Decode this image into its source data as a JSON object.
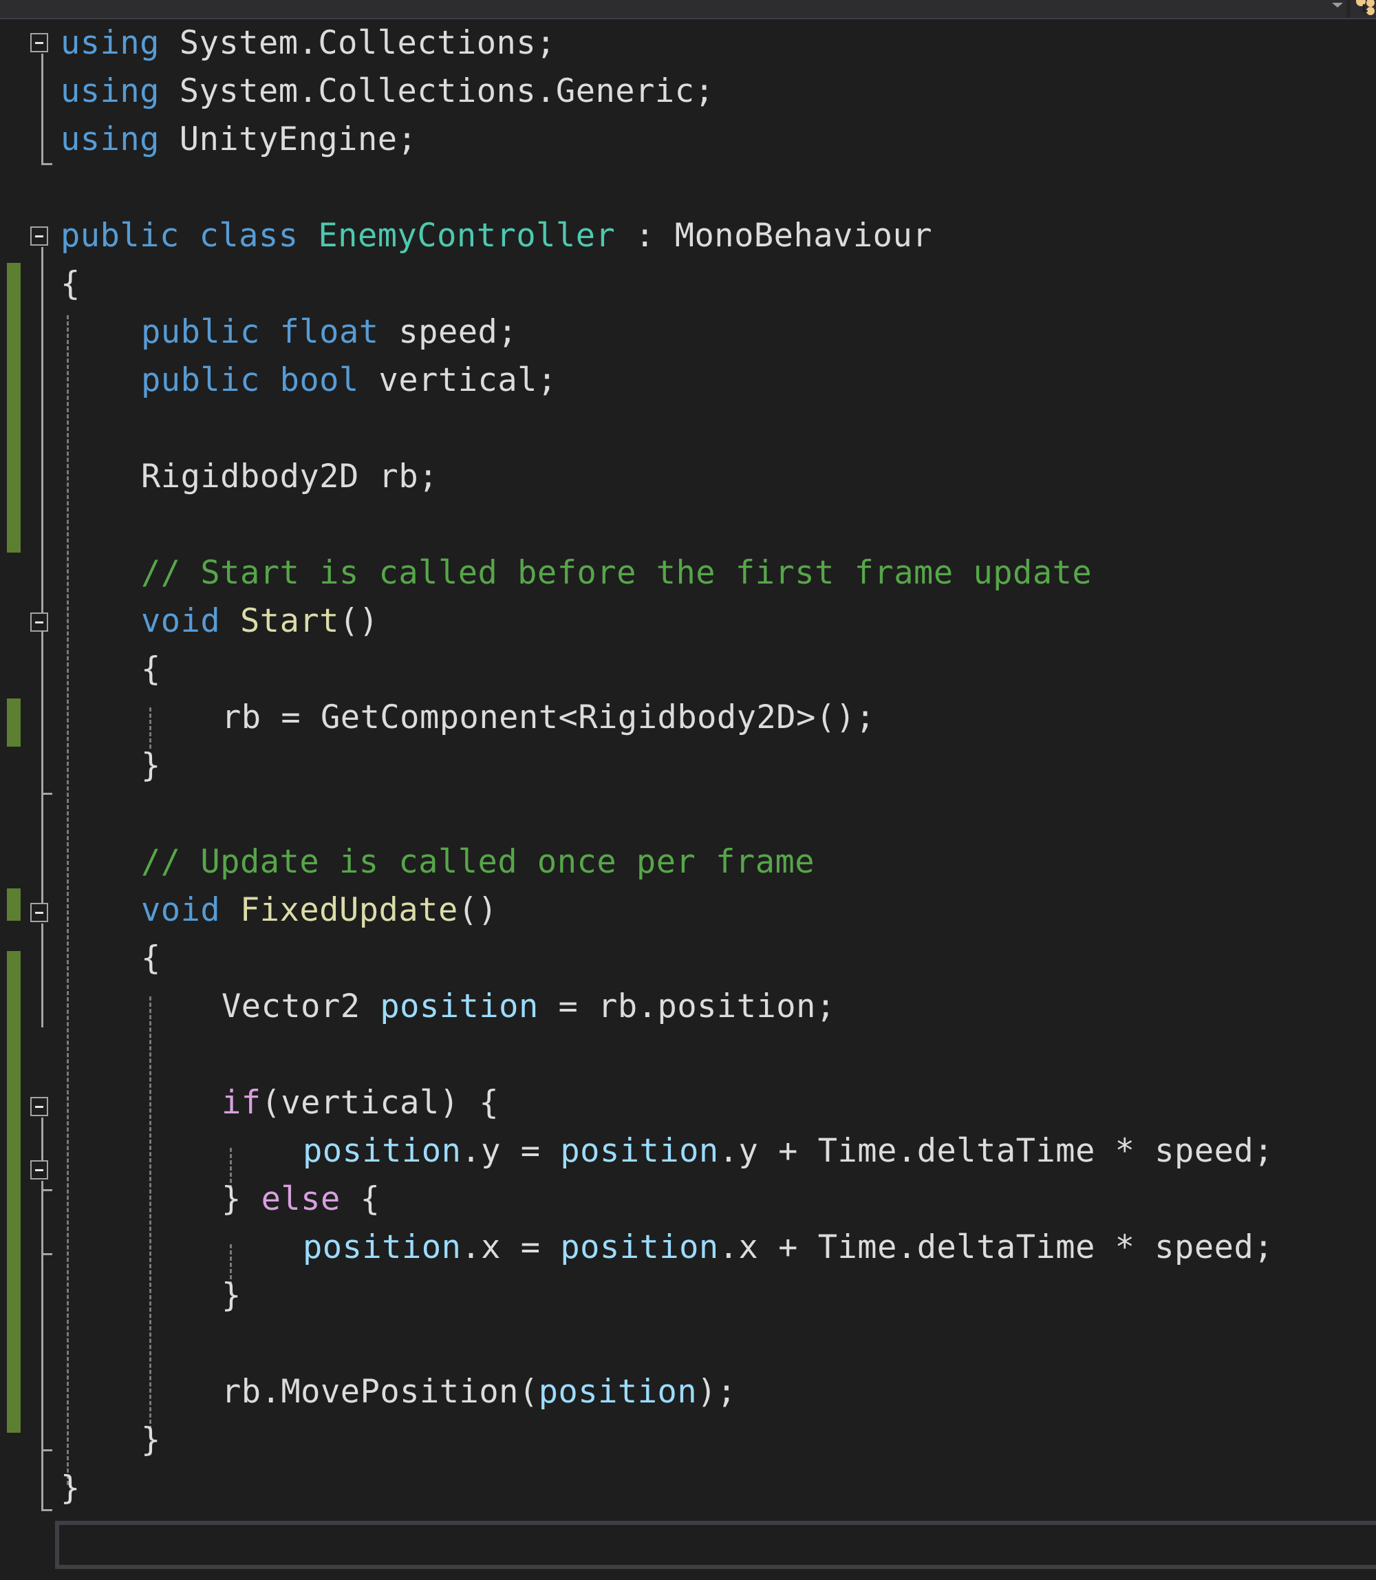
{
  "window": {
    "toolbar_dropdown_icon": "chevron-down-icon",
    "toolbar_icon": "solution-explorer-icon"
  },
  "editor": {
    "language": "C#",
    "file_class": "EnemyController",
    "colors": {
      "background": "#1e1e1e",
      "keyword": "#569cd6",
      "control_keyword": "#d8a0df",
      "type": "#4ec9b0",
      "method": "#dcdcaa",
      "comment": "#57a64a",
      "local": "#9cdcfe",
      "text": "#dcdcdc",
      "change_marker": "#5d7f32"
    },
    "lines": {
      "l1": {
        "t1": "using",
        "t2": " System.Collections;"
      },
      "l2": {
        "t1": "using",
        "t2": " System.Collections.Generic;"
      },
      "l3": {
        "t1": "using",
        "t2": " UnityEngine;"
      },
      "l5": {
        "t1": "public",
        "t2": " ",
        "t3": "class",
        "t4": " ",
        "t5": "EnemyController",
        "t6": " : MonoBehaviour"
      },
      "l6": {
        "t1": "{"
      },
      "l7": {
        "t1": "public",
        "t2": " ",
        "t3": "float",
        "t4": " speed;"
      },
      "l8": {
        "t1": "public",
        "t2": " ",
        "t3": "bool",
        "t4": " vertical;"
      },
      "l10": {
        "t1": "Rigidbody2D rb;"
      },
      "l12": {
        "t1": "// Start is called before the first frame update"
      },
      "l13": {
        "t1": "void",
        "t2": " ",
        "t3": "Start",
        "t4": "()"
      },
      "l14": {
        "t1": "{"
      },
      "l15": {
        "t1": "rb = GetComponent<Rigidbody2D>();"
      },
      "l16": {
        "t1": "}"
      },
      "l18": {
        "t1": "// Update is called once per frame"
      },
      "l19": {
        "t1": "void",
        "t2": " ",
        "t3": "FixedUpdate",
        "t4": "()"
      },
      "l20": {
        "t1": "{"
      },
      "l21": {
        "t1": "Vector2 ",
        "t2": "position",
        "t3": " = rb.position;"
      },
      "l23": {
        "t1": "if",
        "t2": "(vertical) {"
      },
      "l24": {
        "t1": "position",
        "t2": ".y = ",
        "t3": "position",
        "t4": ".y + Time.deltaTime * speed;"
      },
      "l25": {
        "t1": "} ",
        "t2": "else",
        "t3": " {"
      },
      "l26": {
        "t1": "position",
        "t2": ".x = ",
        "t3": "position",
        "t4": ".x + Time.deltaTime * speed;"
      },
      "l27": {
        "t1": "}"
      },
      "l29": {
        "t1": "rb.MovePosition(",
        "t2": "position",
        "t3": ");"
      },
      "l30": {
        "t1": "}"
      },
      "l31": {
        "t1": "}"
      }
    }
  }
}
